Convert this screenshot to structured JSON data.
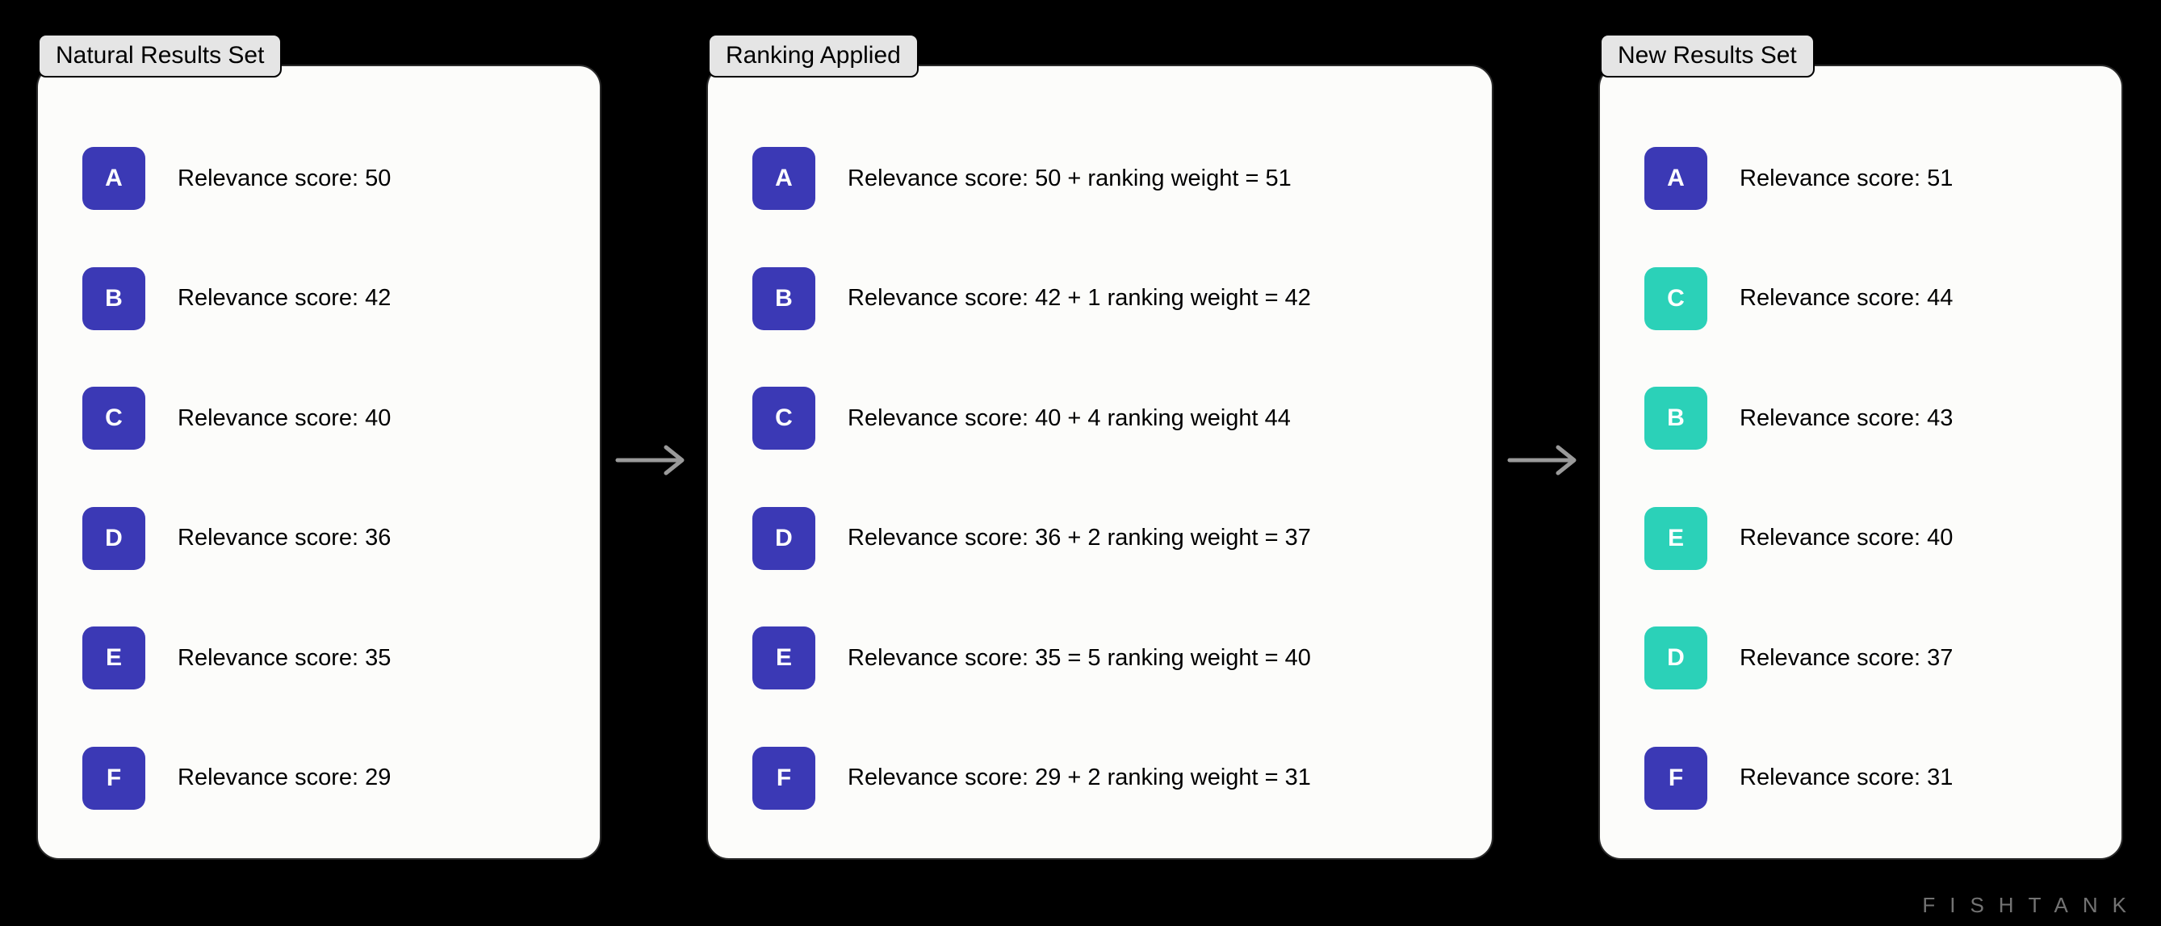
{
  "panels": {
    "natural": {
      "title": "Natural Results Set",
      "items": [
        {
          "letter": "A",
          "text": "Relevance score: 50",
          "color": "indigo"
        },
        {
          "letter": "B",
          "text": "Relevance score: 42",
          "color": "indigo"
        },
        {
          "letter": "C",
          "text": "Relevance score: 40",
          "color": "indigo"
        },
        {
          "letter": "D",
          "text": "Relevance score: 36",
          "color": "indigo"
        },
        {
          "letter": "E",
          "text": "Relevance score: 35",
          "color": "indigo"
        },
        {
          "letter": "F",
          "text": "Relevance score: 29",
          "color": "indigo"
        }
      ]
    },
    "ranking": {
      "title": "Ranking Applied",
      "items": [
        {
          "letter": "A",
          "text": "Relevance score: 50 + ranking weight = 51",
          "color": "indigo"
        },
        {
          "letter": "B",
          "text": "Relevance score: 42 + 1 ranking weight = 42",
          "color": "indigo"
        },
        {
          "letter": "C",
          "text": "Relevance score: 40 + 4 ranking weight 44",
          "color": "indigo"
        },
        {
          "letter": "D",
          "text": "Relevance score: 36 + 2 ranking weight = 37",
          "color": "indigo"
        },
        {
          "letter": "E",
          "text": "Relevance score: 35 = 5 ranking weight = 40",
          "color": "indigo"
        },
        {
          "letter": "F",
          "text": "Relevance score: 29 + 2 ranking weight = 31",
          "color": "indigo"
        }
      ]
    },
    "new": {
      "title": "New Results Set",
      "items": [
        {
          "letter": "A",
          "text": "Relevance score: 51",
          "color": "indigo"
        },
        {
          "letter": "C",
          "text": "Relevance score: 44",
          "color": "teal"
        },
        {
          "letter": "B",
          "text": "Relevance score: 43",
          "color": "teal"
        },
        {
          "letter": "E",
          "text": "Relevance score: 40",
          "color": "teal"
        },
        {
          "letter": "D",
          "text": "Relevance score: 37",
          "color": "teal"
        },
        {
          "letter": "F",
          "text": "Relevance score: 31",
          "color": "indigo"
        }
      ]
    }
  },
  "colors": {
    "indigo": "#3B39B5",
    "teal": "#2BD1B8"
  },
  "watermark": "FISHTANK"
}
